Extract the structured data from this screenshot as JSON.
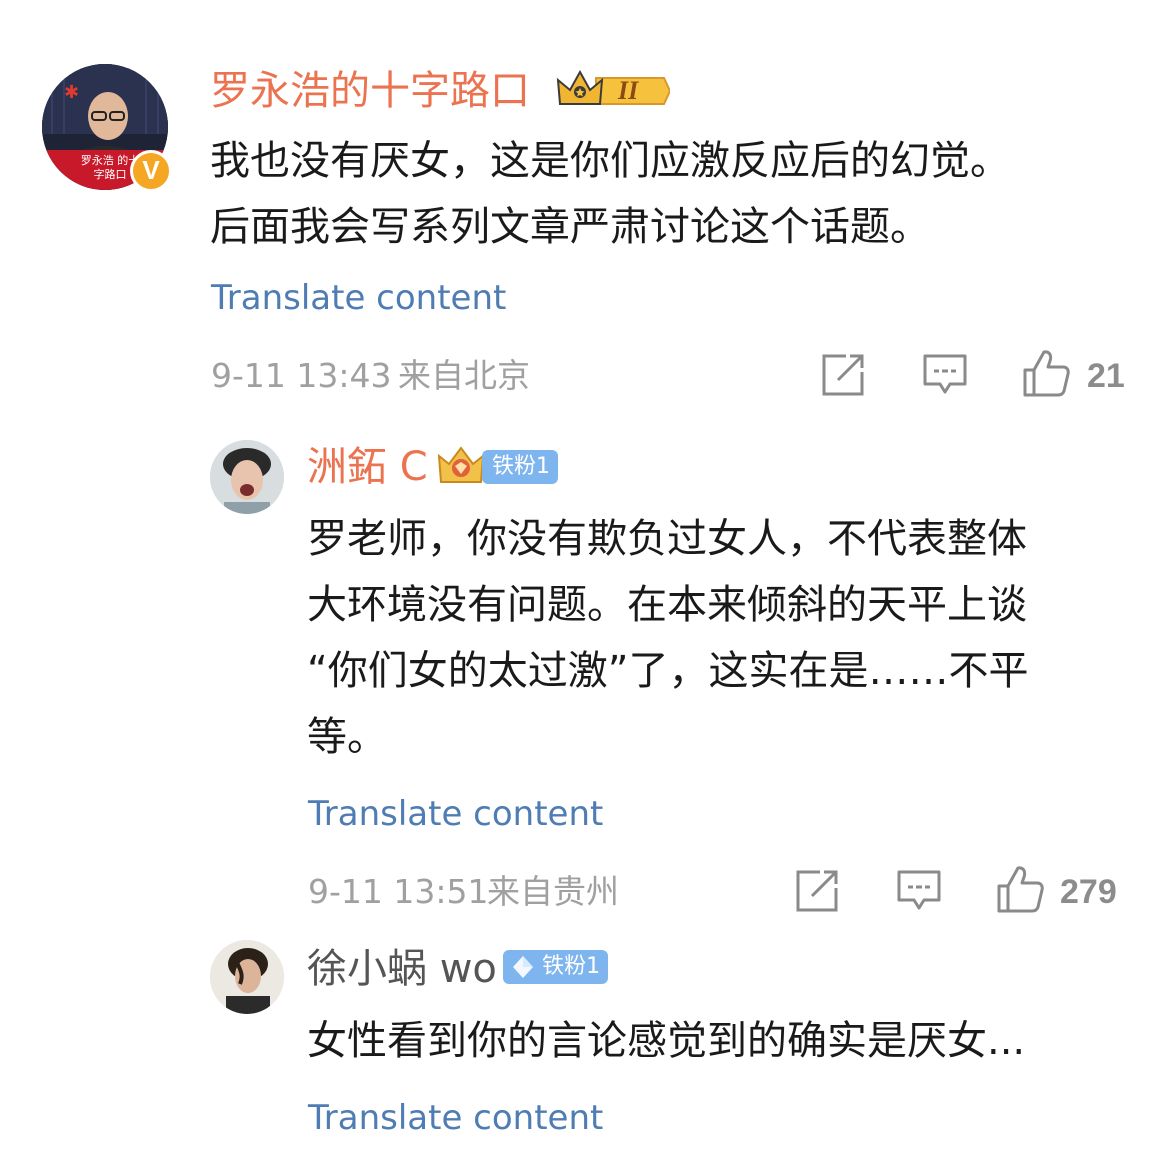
{
  "comments": [
    {
      "username": "罗永浩的十字路口",
      "vip_badge_text": "II",
      "avatar_caption": "罗永浩 的十字路口",
      "lines": [
        "我也没有厌女，这是你们应激反应后的幻觉。",
        "后面我会写系列文章严肃讨论这个话题。"
      ],
      "translate_label": "Translate content",
      "timestamp": "9-11 13:43",
      "location": "来自北京",
      "likes": "21"
    },
    {
      "username": "洲鉐 C",
      "fan_badge": "铁粉1",
      "lines": [
        "罗老师，你没有欺负过女人，不代表整体",
        "大环境没有问题。在本来倾斜的天平上谈",
        "“你们女的太过激”了，这实在是……不平",
        "等。"
      ],
      "translate_label": "Translate content",
      "timestamp": "9-11 13:51",
      "location": "来自贵州",
      "likes": "279"
    },
    {
      "username": "徐小蜗 wo",
      "fan_badge": "铁粉1",
      "lines": [
        "女性看到你的言论感觉到的确实是厌女..."
      ],
      "translate_label": "Translate content"
    }
  ],
  "icons": [
    "share-icon",
    "comment-icon",
    "like-icon",
    "verified-v-icon",
    "crown-vip-icon",
    "diamond-icon",
    "fan-crown-icon"
  ],
  "colors": {
    "username": "#eb7350",
    "link": "#4f7cb3",
    "meta": "#a0a0a0",
    "body": "#1a1a1a",
    "fan_badge": "#7eb5ef",
    "verified": "#f5a623"
  }
}
